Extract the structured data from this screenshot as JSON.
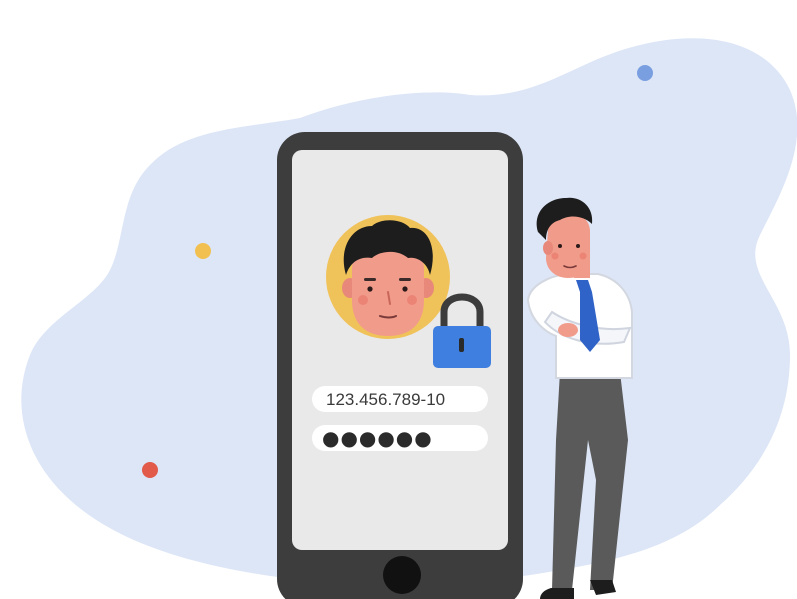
{
  "illustration": {
    "id_field_value": "123.456.789-10",
    "password_field_value": "●●●●●●",
    "icons": [
      "blob-background",
      "smartphone",
      "avatar-face",
      "padlock-icon",
      "businessman-figure",
      "decor-dot"
    ],
    "colors": {
      "blob": "#dde6f7",
      "phone_body": "#3d3d3d",
      "phone_screen": "#e9e9ea",
      "avatar_ring": "#f0c25a",
      "padlock": "#3f7fdf",
      "tie": "#2f63c8",
      "trousers": "#5a5a5a",
      "hair": "#1d1d1d",
      "skin": "#f19b8a",
      "dot_blue": "#7a9fe0",
      "dot_yellow": "#f2c050",
      "dot_red": "#e15a4a"
    }
  }
}
